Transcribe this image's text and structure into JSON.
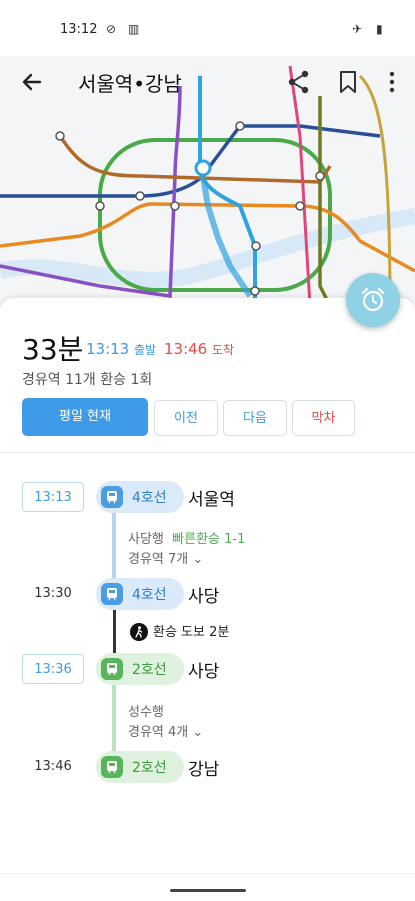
{
  "status": {
    "time": "13:12"
  },
  "appbar": {
    "title": "서울역•강남"
  },
  "route": {
    "duration": "33분",
    "depart_time": "13:13",
    "depart_label": "출발",
    "arrive_time": "13:46",
    "arrive_label": "도착",
    "summary": "경유역 11개  환승 1회"
  },
  "buttons": {
    "current": "평일 현재",
    "prev": "이전",
    "next": "다음",
    "last": "막차"
  },
  "timeline": {
    "seg1": {
      "time": "13:13",
      "line": "4호선",
      "station": "서울역",
      "direction": "사당행",
      "fast": "빠른환승 1-1",
      "stops": "경유역 7개"
    },
    "transfer1": {
      "time": "13:30",
      "line": "4호선",
      "station": "사당"
    },
    "walk": {
      "text": "환승 도보 2분"
    },
    "seg2": {
      "time": "13:36",
      "line": "2호선",
      "station": "사당",
      "direction": "성수행",
      "stops": "경유역 4개"
    },
    "arrival": {
      "time": "13:46",
      "line": "2호선",
      "station": "강남"
    }
  },
  "colors": {
    "line4": "#4a9de2",
    "line2": "#5ab55a",
    "accent": "#3d9be9",
    "arrive": "#e54b4b"
  }
}
